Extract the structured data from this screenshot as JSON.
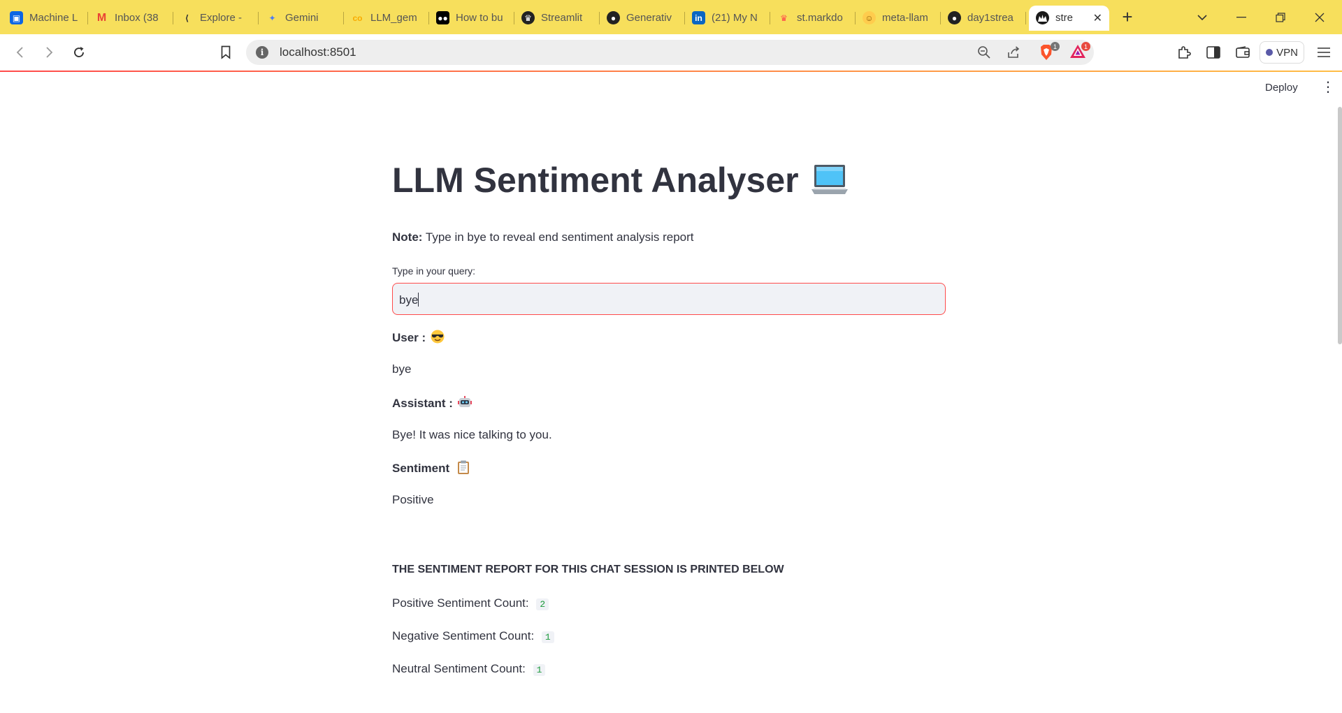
{
  "browser": {
    "tabs": [
      {
        "title": "Machine L",
        "icon": "trello-icon",
        "color": "#0c66e4"
      },
      {
        "title": "Inbox (38",
        "icon": "gmail-icon",
        "color": "#ea4335"
      },
      {
        "title": "Explore - ",
        "icon": "explore-icon",
        "color": "#333333"
      },
      {
        "title": "Gemini",
        "icon": "gemini-icon",
        "color": "#4b7bf5"
      },
      {
        "title": "LLM_gem",
        "icon": "colab-icon",
        "color": "#f9ab00"
      },
      {
        "title": "How to bu",
        "icon": "medium-icon",
        "color": "#000000"
      },
      {
        "title": "Streamlit",
        "icon": "streamlit-icon",
        "color": "#222222"
      },
      {
        "title": "Generativ",
        "icon": "github-icon",
        "color": "#222222"
      },
      {
        "title": "(21) My N",
        "icon": "linkedin-icon",
        "color": "#0a66c2"
      },
      {
        "title": "st.markdo",
        "icon": "streamlit-crown-icon",
        "color": "#ff4b4b"
      },
      {
        "title": "meta-llam",
        "icon": "huggingface-icon",
        "color": "#ffcc4d"
      },
      {
        "title": "day1strea",
        "icon": "github-icon",
        "color": "#222222"
      }
    ],
    "active_tab": {
      "title": "stre",
      "icon": "streamlit-icon"
    },
    "url": "localhost:8501",
    "vpn_label": "VPN",
    "brave_badge": "1",
    "rewards_badge": "1"
  },
  "app": {
    "deploy_label": "Deploy",
    "title": "LLM Sentiment Analyser",
    "note_label": "Note:",
    "note_text": " Type in bye to reveal end sentiment analysis report",
    "query_label": "Type in your query:",
    "query_value": "bye",
    "user_label": "User :",
    "user_message": "bye",
    "assistant_label": "Assistant :",
    "assistant_message": "Bye! It was nice talking to you.",
    "sentiment_label": "Sentiment",
    "sentiment_value": "Positive",
    "report_heading": "THE SENTIMENT REPORT FOR THIS CHAT SESSION IS PRINTED BELOW",
    "positive_label": "Positive Sentiment Count:",
    "positive_count": "2",
    "negative_label": "Negative Sentiment Count:",
    "negative_count": "1",
    "neutral_label": "Neutral Sentiment Count:",
    "neutral_count": "1"
  }
}
